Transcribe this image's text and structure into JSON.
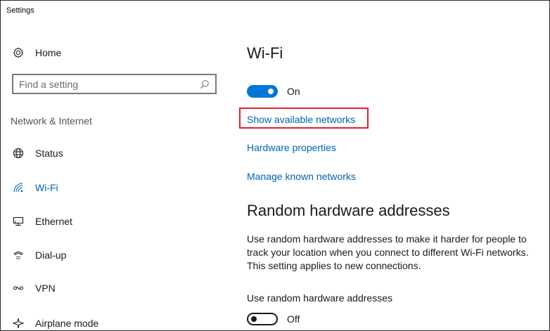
{
  "window": {
    "title": "Settings"
  },
  "sidebar": {
    "home_label": "Home",
    "search_placeholder": "Find a setting",
    "section_label": "Network & Internet",
    "items": [
      {
        "label": "Status",
        "icon": "globe-icon",
        "active": false
      },
      {
        "label": "Wi-Fi",
        "icon": "wifi-icon",
        "active": true
      },
      {
        "label": "Ethernet",
        "icon": "ethernet-icon",
        "active": false
      },
      {
        "label": "Dial-up",
        "icon": "phone-icon",
        "active": false
      },
      {
        "label": "VPN",
        "icon": "vpn-icon",
        "active": false
      },
      {
        "label": "Airplane mode",
        "icon": "airplane-icon",
        "active": false
      }
    ]
  },
  "main": {
    "title": "Wi-Fi",
    "wifi_toggle": {
      "state": "On",
      "on": true
    },
    "links": {
      "show_networks": "Show available networks",
      "hardware_properties": "Hardware properties",
      "manage_networks": "Manage known networks"
    },
    "random_section": {
      "heading": "Random hardware addresses",
      "description_lines": [
        "Use random hardware addresses to make it harder for people to",
        "track your location when you connect to different Wi-Fi networks.",
        "This setting applies to new connections."
      ],
      "setting_label": "Use random hardware addresses",
      "toggle": {
        "state": "Off",
        "on": false
      }
    }
  },
  "colors": {
    "accent": "#0078d7",
    "link": "#0063b1",
    "highlight": "#e0202f"
  }
}
